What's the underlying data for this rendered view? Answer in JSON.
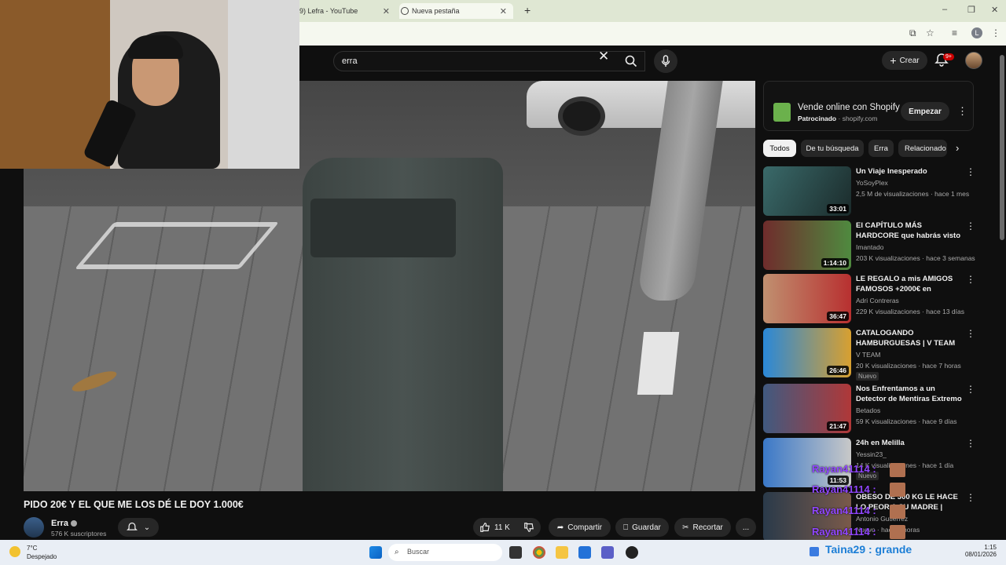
{
  "browser": {
    "tabs": [
      {
        "label": "9) Lefra - YouTube"
      },
      {
        "label": "Nueva pestaña"
      }
    ],
    "new_tab": "+",
    "profile_initial": "L"
  },
  "youtube": {
    "search_value": "erra",
    "create_label": "Crear",
    "notif_badge": "9+"
  },
  "video": {
    "title": "PIDO 20€ Y EL QUE ME LOS DÉ LE DOY 1.000€",
    "channel": "Erra",
    "subscribers": "576 K suscriptores",
    "likes": "11 K",
    "share_label": "Compartir",
    "save_label": "Guardar",
    "clip_label": "Recortar",
    "more": "..."
  },
  "ad": {
    "title": "Vende online con Shopify",
    "sponsored": "Patrocinado",
    "domain": "shopify.com",
    "cta": "Empezar"
  },
  "chips": [
    "Todos",
    "De tu búsqueda",
    "Erra",
    "Relacionado"
  ],
  "recommendations": [
    {
      "title": "Un Viaje Inesperado",
      "channel": "YoSoyPlex",
      "meta": "2,5 M de visualizaciones · hace 1 mes",
      "duration": "33:01",
      "badge": ""
    },
    {
      "title": "El CAPÍTULO MÁS HARDCORE que habrás visto (y con peor ...",
      "channel": "Imantado",
      "meta": "203 K visualizaciones · hace 3 semanas",
      "duration": "1:14:10",
      "badge": ""
    },
    {
      "title": "LE REGALO a mis AMIGOS FAMOSOS +2000€ en REGALO...",
      "channel": "Adri Contreras",
      "meta": "229 K visualizaciones · hace 13 días",
      "duration": "36:47",
      "badge": ""
    },
    {
      "title": "CATALOGANDO HAMBURGUESAS | V TEAM",
      "channel": "V TEAM",
      "meta": "20 K visualizaciones · hace 7 horas",
      "duration": "26:46",
      "badge": "Nuevo"
    },
    {
      "title": "Nos Enfrentamos a un Detector de Mentiras Extremo",
      "channel": "Betados",
      "meta": "59 K visualizaciones · hace 9 días",
      "duration": "21:47",
      "badge": ""
    },
    {
      "title": "24h en Melilla",
      "channel": "Yessin23_",
      "meta": "14 K visualizaciones · hace 1 día",
      "duration": "11:53",
      "badge": "Nuevo"
    },
    {
      "title": "OBESO DE 300 KG LE HACE LO PEOR A SU MADRE | Hermano ...",
      "channel": "Antonio Gutiérrez",
      "meta": "Nuevo · hace 9 horas",
      "duration": "",
      "badge": "Nuevo"
    }
  ],
  "chat_overlay": [
    "Rayan41114 :",
    "Rayan41114 :",
    "Rayan41114 :",
    "Rayan41114 :"
  ],
  "taskbar": {
    "temp": "7°C",
    "weather": "Despejado",
    "search_placeholder": "Buscar",
    "chat_text": "Taina29 : grande",
    "time": "1:15",
    "date": "08/01/2026"
  }
}
